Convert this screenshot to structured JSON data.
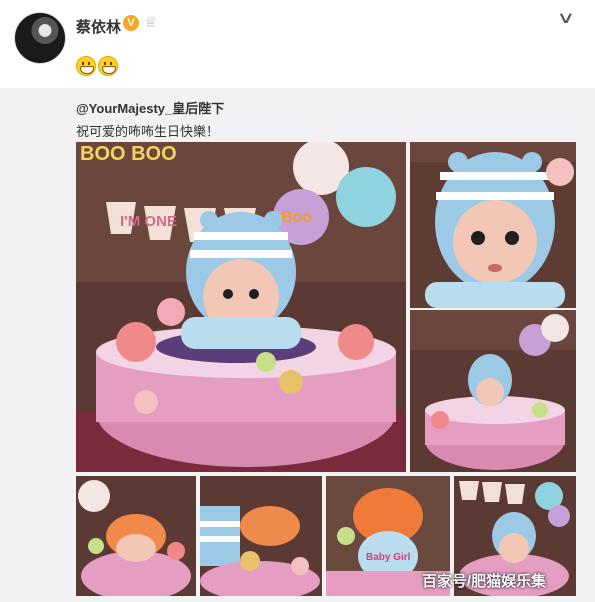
{
  "post": {
    "username": "蔡依林",
    "verified_badge": "V",
    "emoji_names": [
      "grin-emoji",
      "grin-emoji"
    ]
  },
  "repost": {
    "author": "@YourMajesty_皇后陛下",
    "text": "祝可爱的咘咘生日快樂！"
  },
  "photo_signs": {
    "boo_marquee": "BOO BOO",
    "im_one_banner": "I'M ONE",
    "balloon_boo": "Boo",
    "baby_girl_shirt": "Baby Girl"
  },
  "watermark": "百家号/肥猫娱乐集",
  "colors": {
    "verified": "#f5a623",
    "repost_bg": "#f2f2f5",
    "cake_pink": "#e38fb4",
    "hat_stripe": "#8ec2e3"
  }
}
